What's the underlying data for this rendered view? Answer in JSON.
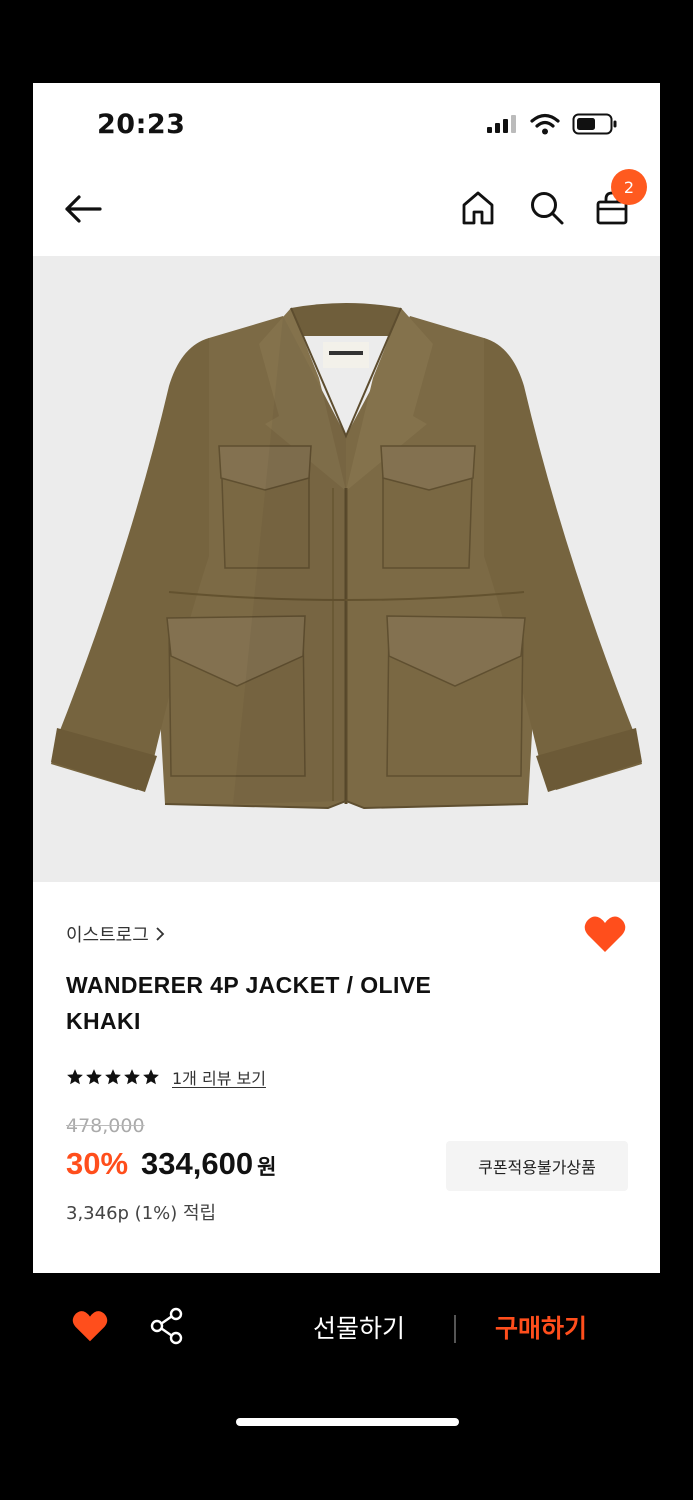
{
  "status_bar": {
    "time": "20:23",
    "icons": [
      "signal-icon",
      "wifi-icon",
      "battery-icon"
    ]
  },
  "header": {
    "icons": [
      "back-arrow-icon",
      "home-icon",
      "search-icon",
      "shopping-bag-icon"
    ],
    "cart_count": "2"
  },
  "product": {
    "image_alt": "olive-khaki-field-jacket",
    "brand": "이스트로그",
    "name": "WANDERER 4P JACKET / OLIVE KHAKI",
    "rating_stars": 5,
    "review_link": "1개 리뷰 보기",
    "original_price": "478,000",
    "discount": "30%",
    "sale_price": "334,600",
    "currency": "원",
    "points": "3,346p (1%) 적립",
    "coupon_notice": "쿠폰적용불가상품",
    "wishlisted": true
  },
  "bottom_bar": {
    "gift_label": "선물하기",
    "buy_label": "구매하기"
  },
  "colors": {
    "accent": "#ff4e1c",
    "badge": "#ff5a1f",
    "image_bg": "#ececec",
    "jacket": "#7c6a45"
  }
}
